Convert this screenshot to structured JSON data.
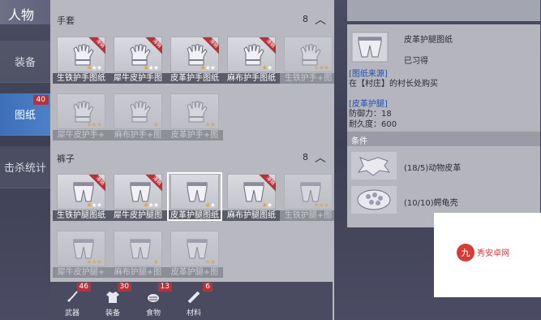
{
  "header": {
    "title": "人物"
  },
  "tabs": [
    {
      "label": "装备"
    },
    {
      "label": "图纸",
      "badge": "40"
    },
    {
      "label": "击杀统计"
    }
  ],
  "section_top": {
    "name": "手套",
    "count": "8"
  },
  "gloves": [
    {
      "label": "生铁护手图纸",
      "tag": "滞销",
      "stars": "★★★",
      "filled": 1
    },
    {
      "label": "犀牛皮护手图",
      "tag": "滞销",
      "stars": "★★★",
      "filled": 1
    },
    {
      "label": "皮革护手图纸",
      "tag": "滞销",
      "stars": "★★★",
      "filled": 1
    },
    {
      "label": "麻布护手图纸",
      "tag": "滞销",
      "stars": "★★",
      "filled": 1
    },
    {
      "label": "生铁护手+图",
      "stars": "★★★",
      "filled": 3,
      "dim": true
    },
    {
      "label": "犀牛皮护手+",
      "stars": "★★★",
      "filled": 3,
      "dim": true
    },
    {
      "label": "麻布护手+图",
      "stars": "★",
      "filled": 1,
      "dim": true
    },
    {
      "label": "皮革护手+图",
      "stars": "★★",
      "filled": 2,
      "dim": true
    }
  ],
  "section_pants": {
    "name": "裤子",
    "count": "8"
  },
  "pants": [
    {
      "label": "生铁护腿图纸",
      "tag": "滞销",
      "stars": "★★★",
      "filled": 1
    },
    {
      "label": "犀牛皮护腿图",
      "tag": "滞销",
      "stars": "★★★",
      "filled": 1
    },
    {
      "label": "皮革护腿图纸",
      "stars": "★★",
      "filled": 1,
      "selected": true
    },
    {
      "label": "麻布护腿图纸",
      "tag": "滞销",
      "stars": "★★",
      "filled": 1
    },
    {
      "label": "生铁护腿+图",
      "stars": "★★★",
      "filled": 3,
      "dim": true
    },
    {
      "label": "犀牛皮护腿+",
      "stars": "★★★",
      "filled": 3,
      "dim": true
    },
    {
      "label": "麻布护腿+图",
      "stars": "★",
      "filled": 1,
      "dim": true
    },
    {
      "label": "皮革护腿+图",
      "stars": "★★",
      "filled": 2,
      "dim": true
    }
  ],
  "bottom_tabs": [
    {
      "label": "武器",
      "badge": "46"
    },
    {
      "label": "装备",
      "badge": "30"
    },
    {
      "label": "食物",
      "badge": "13"
    },
    {
      "label": "材料",
      "badge": "6"
    }
  ],
  "detail": {
    "name": "皮革护腿图纸",
    "status": "已习得",
    "source_title": "[图纸来源]",
    "source_text": "在【村庄】的村长处购买",
    "item_title": "[皮革护腿]",
    "defense": "防御力：18",
    "durability": "耐久度：600",
    "conditions_title": "条件",
    "materials": [
      {
        "text": "(18/5)动物皮革"
      },
      {
        "text": "(10/10)鳄龟壳"
      }
    ]
  },
  "watermark": {
    "text": "九秀安卓网"
  }
}
